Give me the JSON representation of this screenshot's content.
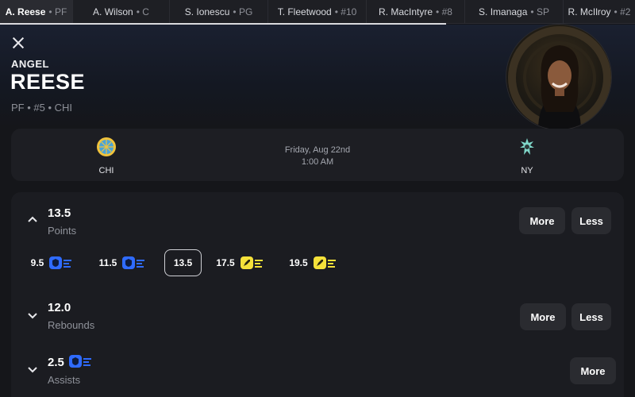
{
  "tabs": [
    {
      "name": "A. Reese",
      "pos": "PF",
      "active": true
    },
    {
      "name": "A. Wilson",
      "pos": "C",
      "active": false
    },
    {
      "name": "S. Ionescu",
      "pos": "PG",
      "active": false
    },
    {
      "name": "T. Fleetwood",
      "pos": "#10",
      "active": false
    },
    {
      "name": "R. MacIntyre",
      "pos": "#8",
      "active": false
    },
    {
      "name": "S. Imanaga",
      "pos": "SP",
      "active": false
    },
    {
      "name": "R. McIlroy",
      "pos": "#2",
      "active": false
    }
  ],
  "player": {
    "first_name": "ANGEL",
    "last_name": "REESE",
    "meta": "PF • #5 • CHI"
  },
  "game": {
    "home_abbr": "CHI",
    "away_abbr": "NY",
    "date": "Friday, Aug 22nd",
    "time": "1:00 AM"
  },
  "props": {
    "points": {
      "line": "13.5",
      "stat": "Points",
      "more_label": "More",
      "less_label": "Less",
      "alt_lines": [
        {
          "value": "9.5",
          "badge": "demon-shield-icon"
        },
        {
          "value": "11.5",
          "badge": "demon-shield-icon"
        },
        {
          "value": "13.5",
          "badge": null,
          "selected": true
        },
        {
          "value": "17.5",
          "badge": "goblin-rocket-icon"
        },
        {
          "value": "19.5",
          "badge": "goblin-rocket-icon"
        }
      ]
    },
    "rebounds": {
      "line": "12.0",
      "stat": "Rebounds",
      "more_label": "More",
      "less_label": "Less"
    },
    "assists": {
      "line": "2.5",
      "stat": "Assists",
      "more_label": "More",
      "badge": "demon-shield-icon"
    }
  },
  "colors": {
    "background": "#15161a",
    "card": "#1d1e23",
    "button": "#2a2b30",
    "demon_blue": "#2f6bff",
    "goblin_yellow": "#f5e13a",
    "chi_gold": "#f0c33c",
    "chi_blue": "#4aa3d8",
    "ny_teal": "#7fd6c8"
  }
}
